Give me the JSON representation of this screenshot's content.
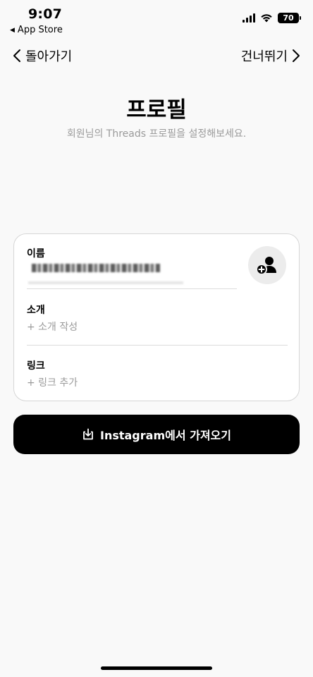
{
  "status_bar": {
    "time": "9:07",
    "back_app": "App Store",
    "battery": "70"
  },
  "nav": {
    "back_label": "돌아가기",
    "skip_label": "건너뛰기"
  },
  "header": {
    "title": "프로필",
    "subtitle": "회원님의 Threads 프로필을 설정해보세요."
  },
  "form": {
    "name_label": "이름",
    "intro_label": "소개",
    "intro_placeholder": "+ 소개 작성",
    "link_label": "링크",
    "link_placeholder": "+ 링크 추가"
  },
  "import_button": {
    "label": "Instagram에서 가져오기"
  }
}
